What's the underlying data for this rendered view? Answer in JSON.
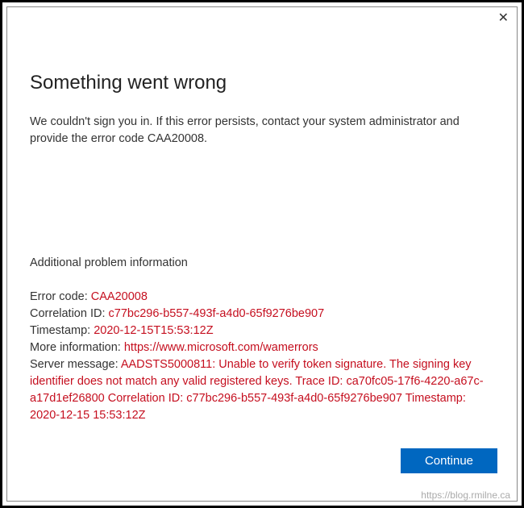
{
  "dialog": {
    "title": "Something went wrong",
    "message": "We couldn't sign you in. If this error persists, contact your system administrator and provide the error code CAA20008.",
    "section_label": "Additional problem information",
    "details": {
      "error_code_label": "Error code: ",
      "error_code_value": "CAA20008",
      "correlation_label": "Correlation ID: ",
      "correlation_value": "c77bc296-b557-493f-a4d0-65f9276be907",
      "timestamp_label": "Timestamp: ",
      "timestamp_value": "2020-12-15T15:53:12Z",
      "moreinfo_label": "More information: ",
      "moreinfo_value": "https://www.microsoft.com/wamerrors",
      "servermsg_label": "Server message: ",
      "servermsg_value": "AADSTS5000811: Unable to verify token signature. The signing key identifier does not match any valid registered keys. Trace ID: ca70fc05-17f6-4220-a67c-a17d1ef26800 Correlation ID: c77bc296-b557-493f-a4d0-65f9276be907 Timestamp: 2020-12-15 15:53:12Z"
    },
    "continue_label": "Continue"
  },
  "watermark": "https://blog.rmilne.ca"
}
